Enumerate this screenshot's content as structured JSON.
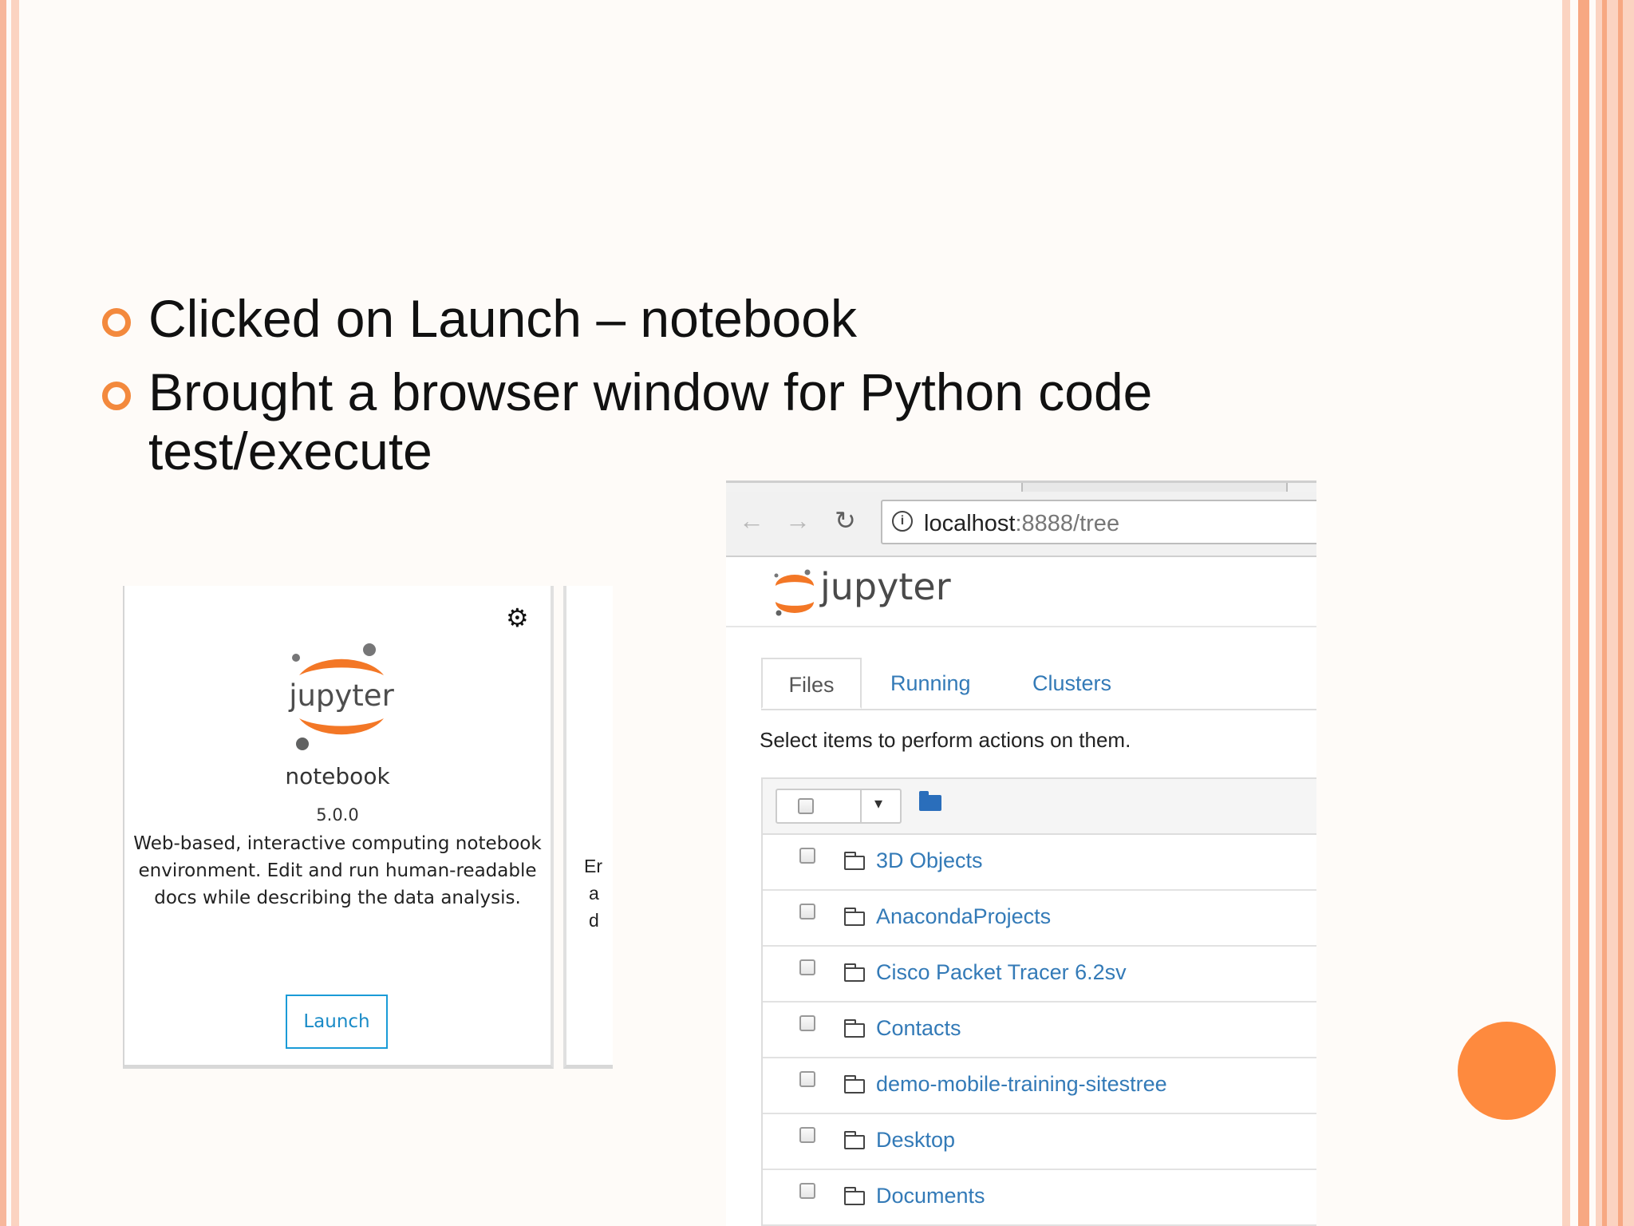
{
  "bullets": [
    "Clicked on Launch – notebook",
    "Brought a browser window for Python code test/execute"
  ],
  "launcher": {
    "app_name": "notebook",
    "version": "5.0.0",
    "description": "Web-based, interactive computing notebook environment. Edit and run human-readable docs while describing the data analysis.",
    "logo_text": "jupyter",
    "launch_label": "Launch",
    "next_card_fragments": [
      "Er",
      "a",
      "d"
    ],
    "icons": {
      "settings": "gear-icon"
    }
  },
  "browser": {
    "url_host": "localhost",
    "url_rest": ":8888/tree",
    "brand": "jupyter",
    "tabs": [
      {
        "label": "Files",
        "active": true
      },
      {
        "label": "Running",
        "active": false
      },
      {
        "label": "Clusters",
        "active": false
      }
    ],
    "hint": "Select items to perform actions on them.",
    "files": [
      "3D Objects",
      "AnacondaProjects",
      "Cisco Packet Tracer 6.2sv",
      "Contacts",
      "demo-mobile-training-sitestree",
      "Desktop",
      "Documents"
    ]
  },
  "colors": {
    "accent_orange": "#f37726",
    "bullet_orange": "#f3893d",
    "link_blue": "#337ab7",
    "launch_blue": "#1a9bd7"
  }
}
